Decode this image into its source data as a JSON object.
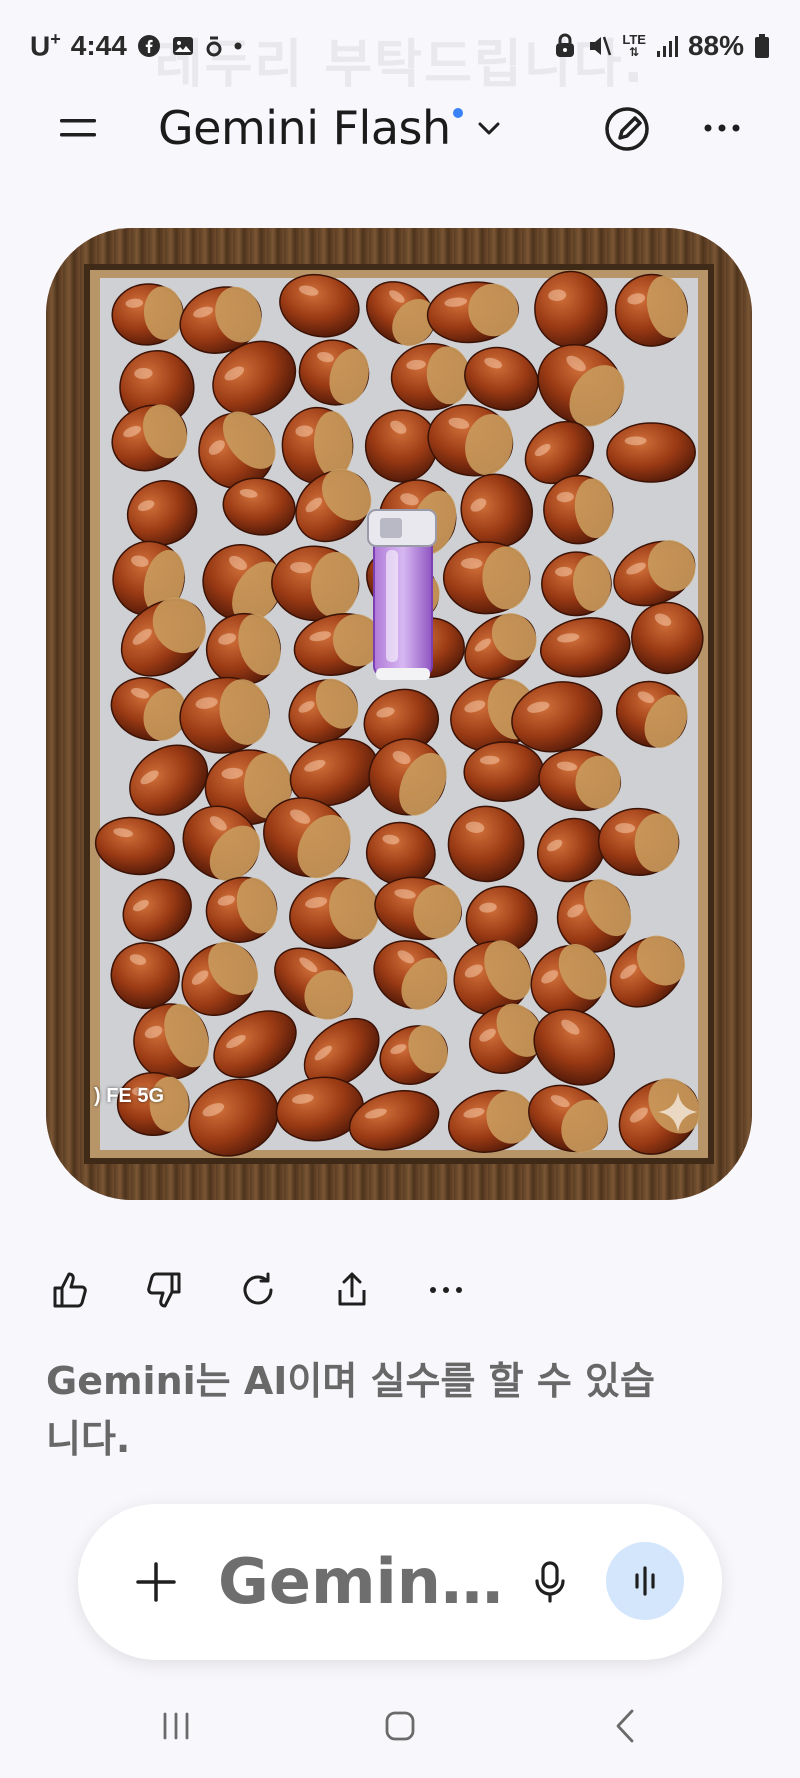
{
  "status_bar": {
    "carrier": "U",
    "carrier_sup": "+",
    "time": "4:44",
    "battery": "88%",
    "network": "LTE",
    "background_text": "레두리 부탁드립니다."
  },
  "header": {
    "title": "Gemini Flash",
    "menu_icon": "hamburger-menu-icon",
    "chevron_icon": "chevron-down-icon",
    "edit_icon": "edit-pen-icon",
    "more_icon": "more-horizontal-icon"
  },
  "photo": {
    "description_icon": "gemini-sparkle-icon",
    "watermark": ") FE 5G"
  },
  "actions": [
    {
      "name": "thumbs-up-icon"
    },
    {
      "name": "thumbs-down-icon"
    },
    {
      "name": "regenerate-icon"
    },
    {
      "name": "share-icon"
    },
    {
      "name": "more-horizontal-icon"
    }
  ],
  "disclaimer": "Gemini는 AI이며 실수를 할 수 있습니다.",
  "input": {
    "placeholder": "Gemini...",
    "plus_icon": "plus-icon",
    "mic_icon": "microphone-icon",
    "live_icon": "live-waveform-icon"
  },
  "colors": {
    "background": "#f8f7fb",
    "accent_dot": "#3a82f7",
    "live_button": "#d4e6fb",
    "disclaimer_text": "#686868"
  }
}
